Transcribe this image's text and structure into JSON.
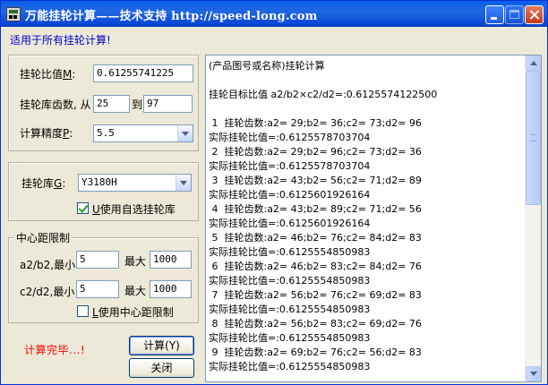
{
  "window": {
    "title": "万能挂轮计算——技术支持 http://speed-long.com",
    "subtitle": "适用于所有挂轮计算!"
  },
  "params": {
    "ratio_label": "挂轮比值",
    "ratio_hotkey": "M",
    "ratio_value": "0.61255741225",
    "teeth_label": "挂轮库齿数, 从",
    "teeth_from": "25",
    "teeth_to_label": "到",
    "teeth_to": "97",
    "precision_label": "计算精度",
    "precision_hotkey": "P",
    "precision_value": "5.5"
  },
  "library": {
    "label": "挂轮库",
    "hotkey": "G",
    "selected": "Y3180H",
    "custom_checkbox_label": "使用自选挂轮库",
    "custom_checkbox_hotkey": "U",
    "custom_checked": true
  },
  "center_distance": {
    "group_title": "中心距限制",
    "ab_label": "a2/b2,最小",
    "ab_min": "5",
    "ab_max_label": "最大",
    "ab_max": "1000",
    "cd_label": "c2/d2,最小",
    "cd_min": "5",
    "cd_max_label": "最大",
    "cd_max": "1000",
    "checkbox_label": "使用中心距限制",
    "checkbox_hotkey": "L",
    "checked": false
  },
  "status": "计算完毕...!",
  "buttons": {
    "calc": "计算(Y)",
    "close": "关闭"
  },
  "output": {
    "lines": [
      "(产品图号或名称)挂轮计算",
      "",
      "挂轮目标比值 a2/b2×c2/d2=:0.6125574122500",
      "",
      " 1  挂轮齿数:a2= 29;b2= 36;c2= 73;d2= 96",
      "实际挂轮比值=:0.6125578703704",
      " 2  挂轮齿数:a2= 29;b2= 96;c2= 73;d2= 36",
      "实际挂轮比值=:0.6125578703704",
      " 3  挂轮齿数:a2= 43;b2= 56;c2= 71;d2= 89",
      "实际挂轮比值=:0.6125601926164",
      " 4  挂轮齿数:a2= 43;b2= 89;c2= 71;d2= 56",
      "实际挂轮比值=:0.6125601926164",
      " 5  挂轮齿数:a2= 46;b2= 76;c2= 84;d2= 83",
      "实际挂轮比值=:0.6125554850983",
      " 6  挂轮齿数:a2= 46;b2= 83;c2= 84;d2= 76",
      "实际挂轮比值=:0.6125554850983",
      " 7  挂轮齿数:a2= 56;b2= 76;c2= 69;d2= 83",
      "实际挂轮比值=:0.6125554850983",
      " 8  挂轮齿数:a2= 56;b2= 83;c2= 69;d2= 76",
      "实际挂轮比值=:0.6125554850983",
      " 9  挂轮齿数:a2= 69;b2= 76;c2= 56;d2= 83",
      "实际挂轮比值=:0.6125554850983"
    ]
  }
}
